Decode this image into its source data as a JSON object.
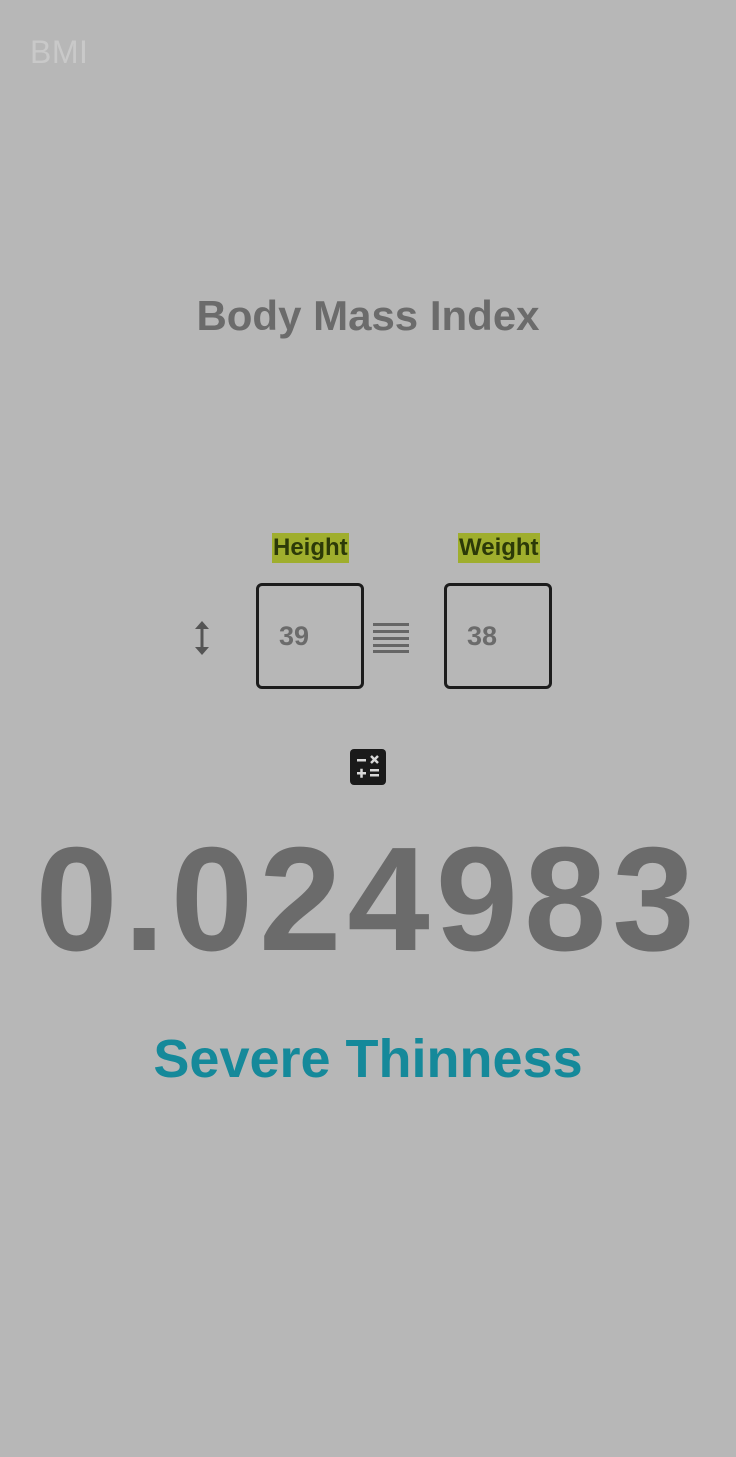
{
  "app": {
    "title": "BMI"
  },
  "main": {
    "title": "Body Mass Index",
    "height": {
      "label": "Height",
      "value": "39",
      "icon": "vertical-arrows-icon"
    },
    "weight": {
      "label": "Weight",
      "value": "38",
      "icon": "weight-lines-icon"
    },
    "calculate": {
      "icon": "calculator-icon"
    },
    "result": {
      "value": "0.024983",
      "category": "Severe Thinness"
    }
  },
  "colors": {
    "background": "#b7b7b7",
    "label_highlight": "#9fae2d",
    "category_text": "#15899a",
    "primary_text": "#6b6b6b"
  }
}
